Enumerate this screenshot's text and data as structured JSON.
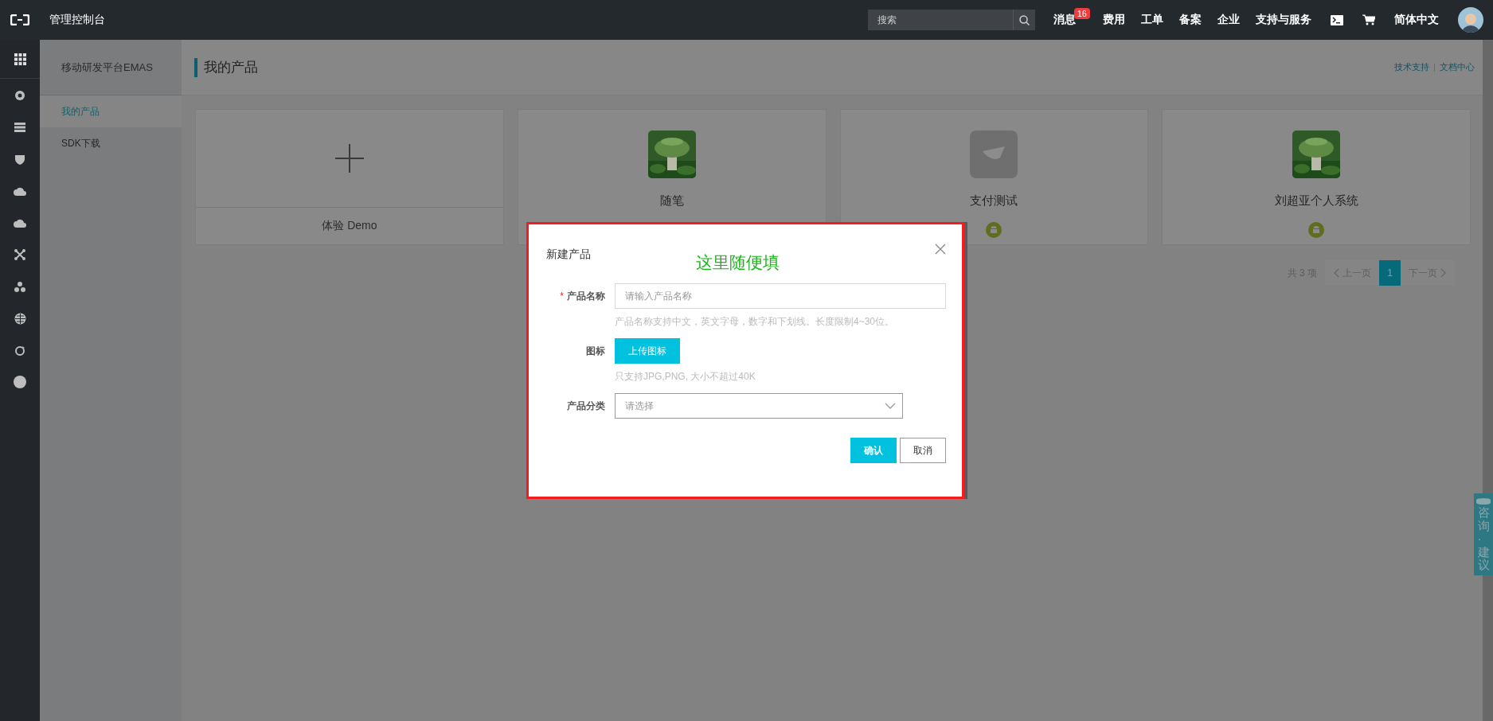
{
  "topbar": {
    "title": "管理控制台",
    "search": {
      "placeholder": "搜索"
    },
    "nav": [
      {
        "label": "消息",
        "badge": "16"
      },
      {
        "label": "费用"
      },
      {
        "label": "工单"
      },
      {
        "label": "备案"
      },
      {
        "label": "企业"
      },
      {
        "label": "支持与服务"
      }
    ],
    "language": "简体中文"
  },
  "sidebar": {
    "title": "移动研发平台EMAS",
    "items": [
      {
        "label": "我的产品",
        "selected": true
      },
      {
        "label": "SDK下载",
        "selected": false
      }
    ]
  },
  "page_header": {
    "title": "我的产品",
    "links": [
      "技术支持",
      "文档中心"
    ]
  },
  "cards": [
    {
      "kind": "add",
      "label": "体验 Demo"
    },
    {
      "name": "随笔"
    },
    {
      "kind": "plain",
      "name": "支付测试",
      "android": true
    },
    {
      "name": "刘超亚个人系统",
      "android": true
    }
  ],
  "pagination": {
    "total": "共 3 项",
    "prev": "上一页",
    "pages": [
      {
        "label": "1",
        "selected": true
      }
    ],
    "next": "下一页"
  },
  "dialog": {
    "title": "新建产品",
    "annotation": "这里随便填",
    "fields": [
      {
        "kind": "text",
        "required_mark": "*",
        "label": "产品名称",
        "placeholder": "请输入产品名称",
        "hint": "产品名称支持中文，英文字母，数字和下划线。长度限制4~30位。"
      },
      {
        "kind": "upload",
        "label": "图标",
        "button": "上传图标",
        "hint": "只支持JPG,PNG, 大小不超过40K"
      },
      {
        "kind": "select",
        "label": "产品分类",
        "placeholder": "请选择"
      }
    ],
    "buttons": [
      {
        "label": "确认",
        "primary": true
      },
      {
        "label": "取消",
        "primary": false
      }
    ]
  },
  "feedback_tab": "咨询·建议"
}
